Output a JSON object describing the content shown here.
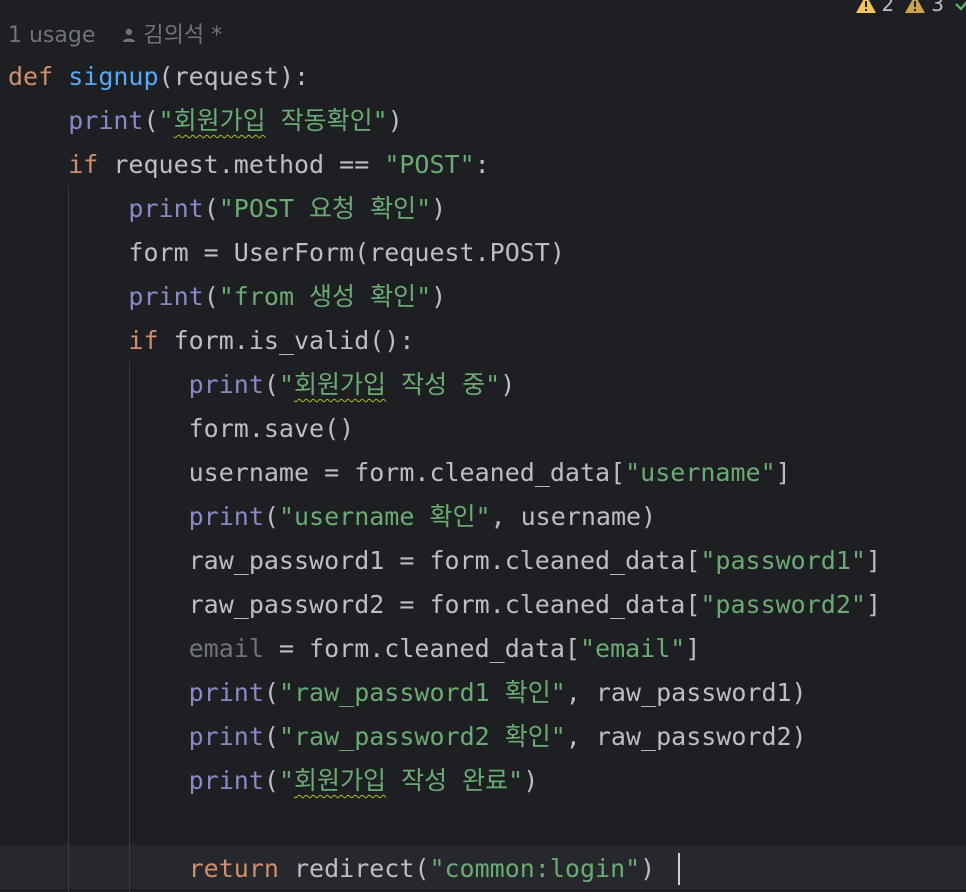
{
  "header": {
    "usages": "1 usage",
    "author": "김의석 *",
    "warnings": [
      {
        "icon": "warning-icon",
        "count": "2"
      },
      {
        "icon": "warning-icon",
        "count": "3"
      }
    ],
    "status_icon": "check-icon",
    "warning_color": "#f2c55c"
  },
  "code": {
    "l1": {
      "kw": "def",
      "name": "signup",
      "args": "(request):"
    },
    "l2": {
      "fn": "print",
      "open": "(",
      "q1": "\"",
      "ko": "회원가입",
      "rest": " 작동확인\"",
      "close": ")"
    },
    "l3": {
      "kw": "if",
      "expr": " request.method == ",
      "str": "\"POST\"",
      "end": ":"
    },
    "l4": {
      "fn": "print",
      "open": "(",
      "str": "\"POST 요청 확인\"",
      "close": ")"
    },
    "l5": {
      "text": "form = UserForm(request.POST)"
    },
    "l6": {
      "fn": "print",
      "open": "(",
      "str": "\"from 생성 확인\"",
      "close": ")"
    },
    "l7": {
      "kw": "if",
      "expr": " form.is_valid():"
    },
    "l8": {
      "fn": "print",
      "open": "(",
      "q1": "\"",
      "ko": "회원가입",
      "rest": " 작성 중\"",
      "close": ")"
    },
    "l9": {
      "text": "form.save()"
    },
    "l10": {
      "pre": "username = form.cleaned_data[",
      "str": "\"username\"",
      "post": "]"
    },
    "l11": {
      "fn": "print",
      "open": "(",
      "str": "\"username 확인\"",
      "post": ", username)"
    },
    "l12": {
      "pre": "raw_password1 = form.cleaned_data[",
      "str": "\"password1\"",
      "post": "]"
    },
    "l13": {
      "pre": "raw_password2 = form.cleaned_data[",
      "str": "\"password2\"",
      "post": "]"
    },
    "l14": {
      "var": "email",
      "pre": " = form.cleaned_data[",
      "str": "\"email\"",
      "post": "]"
    },
    "l15": {
      "fn": "print",
      "open": "(",
      "str": "\"raw_password1 확인\"",
      "post": ", raw_password1)"
    },
    "l16": {
      "fn": "print",
      "open": "(",
      "str": "\"raw_password2 확인\"",
      "post": ", raw_password2)"
    },
    "l17": {
      "fn": "print",
      "open": "(",
      "q1": "\"",
      "ko": "회원가입",
      "rest": " 작성 완료\"",
      "close": ")"
    },
    "l19": {
      "kw": "return",
      "call": " redirect(",
      "str": "\"common:login\"",
      "close": ")"
    }
  }
}
